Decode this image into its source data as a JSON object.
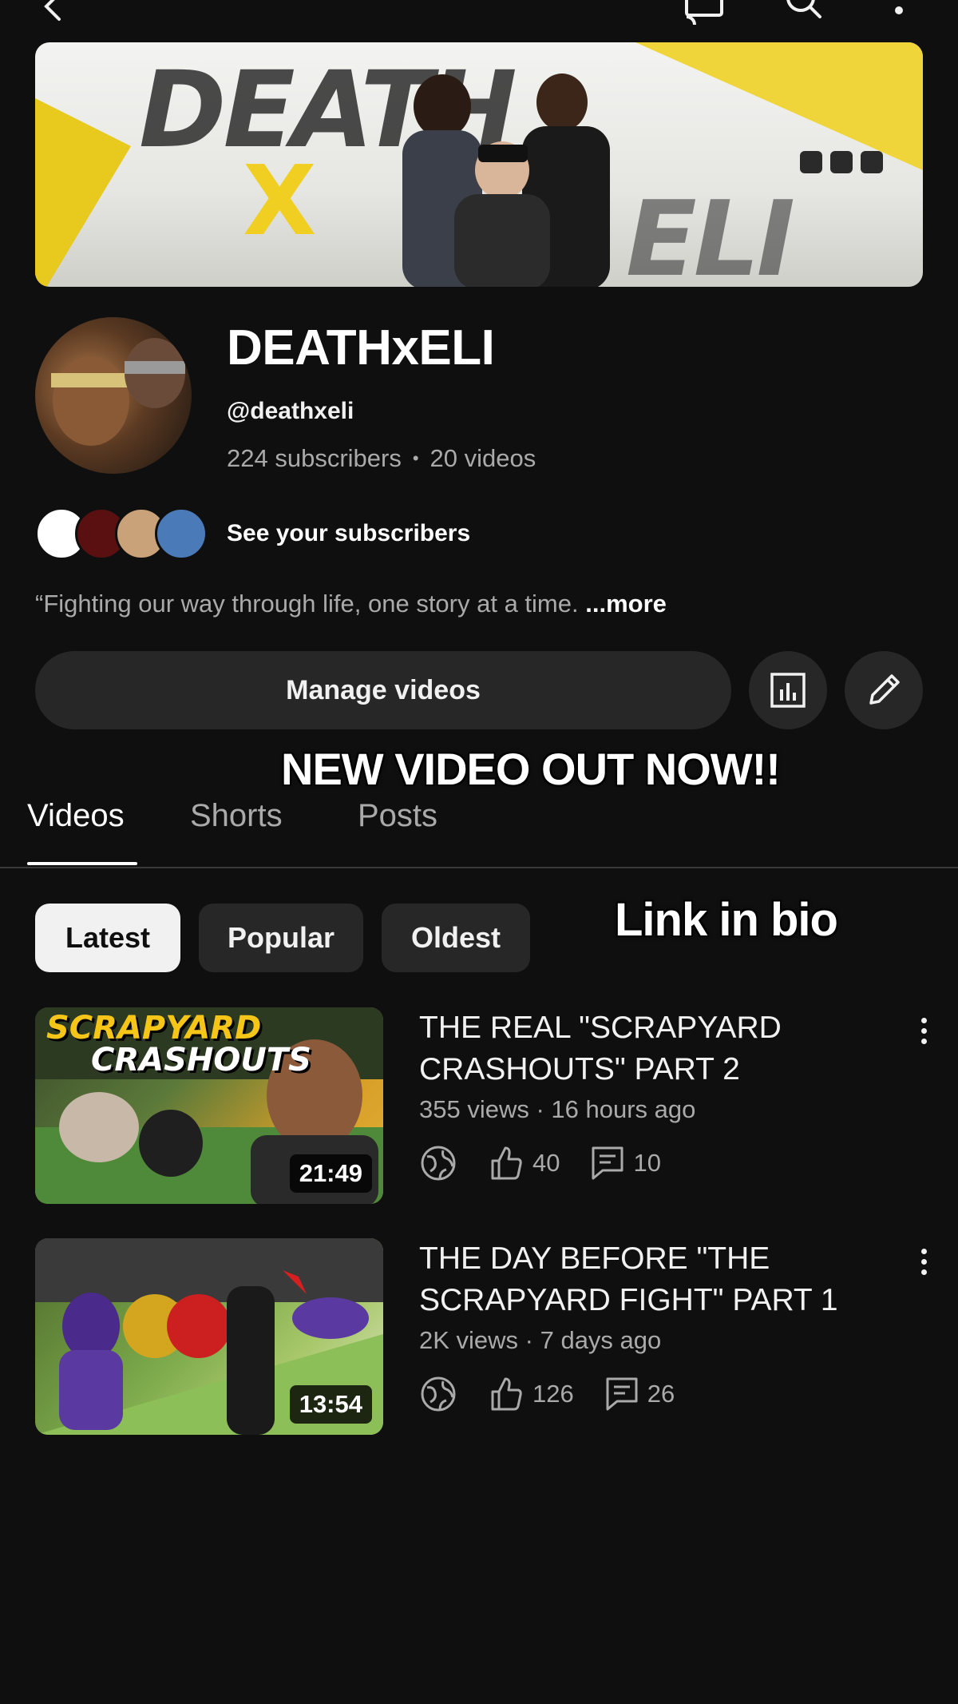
{
  "channel": {
    "name": "DEATHxELI",
    "handle": "@deathxeli",
    "subscribers": "224 subscribers",
    "video_count": "20 videos",
    "see_subscribers": "See your subscribers",
    "description": "“Fighting our way through life, one story at a time.",
    "more_label": "...more"
  },
  "banner": {
    "word_left": "DEATH",
    "word_x": "X",
    "word_right": "ELI"
  },
  "actions": {
    "manage_videos": "Manage videos"
  },
  "overlay": {
    "line1": "NEW VIDEO OUT NOW!!",
    "line2": "Link in bio"
  },
  "tabs": [
    {
      "label": "Videos",
      "active": true
    },
    {
      "label": "Shorts",
      "active": false
    },
    {
      "label": "Posts",
      "active": false
    }
  ],
  "filters": [
    {
      "label": "Latest",
      "selected": true
    },
    {
      "label": "Popular",
      "selected": false
    },
    {
      "label": "Oldest",
      "selected": false
    }
  ],
  "videos": [
    {
      "title": "THE REAL \"SCRAPYARD CRASHOUTS\" PART 2",
      "meta": "355 views · 16 hours ago",
      "duration": "21:49",
      "likes": "40",
      "comments": "10",
      "thumb_text_1": "SCRAPYARD",
      "thumb_text_2": "CRASHOUTS"
    },
    {
      "title": "THE DAY BEFORE \"THE SCRAPYARD FIGHT\" PART 1",
      "meta": "2K views · 7 days ago",
      "duration": "13:54",
      "likes": "126",
      "comments": "26"
    }
  ],
  "icons": {
    "back": "back-arrow-icon",
    "cast": "cast-icon",
    "search": "search-icon",
    "more": "more-vertical-icon",
    "analytics": "analytics-icon",
    "edit": "pencil-icon",
    "visibility": "globe-icon",
    "likes": "thumbs-up-icon",
    "comments": "comment-icon"
  },
  "colors": {
    "background": "#0f0f0f",
    "surface": "#272727",
    "text_primary": "#f1f1f1",
    "text_secondary": "#aaaaaa",
    "banner_accent": "#f0cf22"
  }
}
